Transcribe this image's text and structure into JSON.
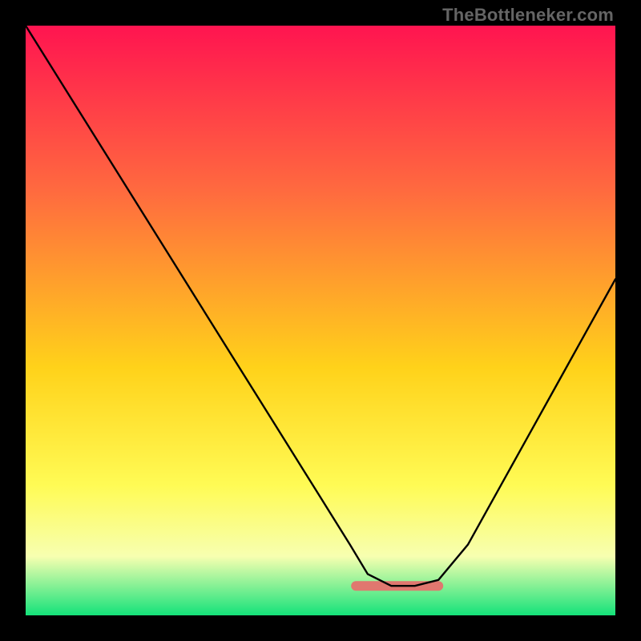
{
  "watermark": "TheBottleneker.com",
  "colors": {
    "top": "#ff1450",
    "mid1": "#ff6a3f",
    "mid2": "#ffd21a",
    "mid3": "#fffb55",
    "mid_low": "#f7ffb0",
    "green": "#14e27a",
    "frame": "#000000",
    "curve": "#000000",
    "band": "#e0776f"
  },
  "chart_data": {
    "type": "line",
    "title": "",
    "xlabel": "",
    "ylabel": "",
    "xlim": [
      0,
      100
    ],
    "ylim": [
      0,
      100
    ],
    "optimum_band": {
      "x_start": 56,
      "x_end": 70,
      "y": 5
    },
    "series": [
      {
        "name": "bottleneck-curve",
        "x": [
          0,
          5,
          10,
          15,
          20,
          25,
          30,
          35,
          40,
          45,
          50,
          55,
          58,
          62,
          66,
          70,
          75,
          80,
          85,
          90,
          95,
          100
        ],
        "values": [
          100,
          92,
          84,
          76,
          68,
          60,
          52,
          44,
          36,
          28,
          20,
          12,
          7,
          5,
          5,
          6,
          12,
          21,
          30,
          39,
          48,
          57
        ]
      }
    ],
    "background_gradient_stops": [
      {
        "offset": 0,
        "color": "#ff1450"
      },
      {
        "offset": 28,
        "color": "#ff6a3f"
      },
      {
        "offset": 58,
        "color": "#ffd21a"
      },
      {
        "offset": 78,
        "color": "#fffb55"
      },
      {
        "offset": 90,
        "color": "#f7ffb0"
      },
      {
        "offset": 100,
        "color": "#14e27a"
      }
    ]
  }
}
